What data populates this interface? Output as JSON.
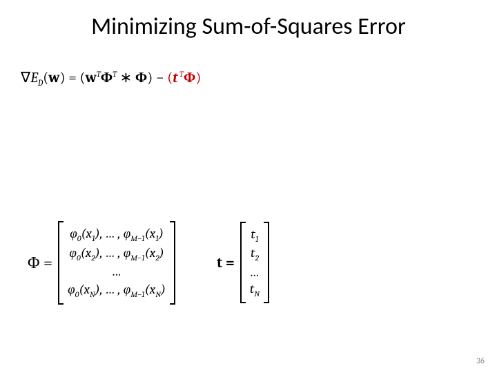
{
  "title": "Minimizing Sum-of-Squares Error",
  "equation": {
    "nabla": "∇",
    "E": "E",
    "D": "D",
    "lparen": "(",
    "w": "w",
    "rparen": ")",
    "eq": " = ",
    "open": "(",
    "wT": "w",
    "T1": "T",
    "Phi1": "Φ",
    "T2": "T",
    "star": " ∗ ",
    "Phi2": "Φ",
    "close": ")",
    "minus": " − ",
    "open2": "(",
    "t": "t",
    "T3": " T",
    "Phi3": "Φ",
    "close2": ")"
  },
  "phi_matrix": {
    "lhs": "Φ =",
    "rows": [
      "φ₀(x₁), … , φ_{M−1}(x₁)",
      "φ₀(x₂), … , φ_{M−1}(x₂)",
      "…",
      "φ₀(x_N), … , φ_{M−1}(x_N)"
    ]
  },
  "t_vector": {
    "lhs": "t =",
    "rows": [
      "t₁",
      "t₂",
      "…",
      "t_N"
    ]
  },
  "page_number": "36"
}
